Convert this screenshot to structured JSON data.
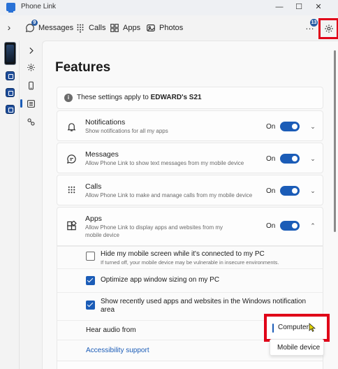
{
  "window": {
    "title": "Phone Link",
    "minimize": "—",
    "maximize": "☐",
    "close": "✕"
  },
  "topnav": {
    "expand_glyph": "›",
    "tabs": [
      {
        "label": "Messages",
        "icon": "message-icon",
        "badge": "9"
      },
      {
        "label": "Calls",
        "icon": "dialpad-icon"
      },
      {
        "label": "Apps",
        "icon": "apps-grid-icon"
      },
      {
        "label": "Photos",
        "icon": "photos-icon"
      }
    ],
    "more_glyph": "…",
    "more_badge": "13",
    "settings_icon": "gear-icon"
  },
  "rail": {
    "items": [
      {
        "name": "expand",
        "icon": "chevron-right-icon"
      },
      {
        "name": "general",
        "icon": "gear-icon"
      },
      {
        "name": "devices",
        "icon": "phone-icon"
      },
      {
        "name": "features",
        "icon": "list-icon",
        "active": true
      },
      {
        "name": "accessibility",
        "icon": "link-icon"
      }
    ]
  },
  "page": {
    "title": "Features",
    "info": {
      "prefix": "These settings apply to ",
      "device": "EDWARD's S21"
    },
    "features": [
      {
        "title": "Notifications",
        "desc": "Show notifications for all my apps",
        "state": "On",
        "icon": "bell-icon"
      },
      {
        "title": "Messages",
        "desc": "Allow Phone Link to show text messages from my mobile device",
        "state": "On",
        "icon": "chat-icon"
      },
      {
        "title": "Calls",
        "desc": "Allow Phone Link to make and manage calls from my mobile device",
        "state": "On",
        "icon": "dialpad-icon"
      },
      {
        "title": "Apps",
        "desc": "Allow Phone Link to display apps and websites from my mobile device",
        "state": "On",
        "icon": "apps-icon"
      }
    ],
    "apps_options": [
      {
        "label": "Hide my mobile screen while it's connected to my PC",
        "desc": "If turned off, your mobile device may be vulnerable in insecure environments.",
        "checked": false
      },
      {
        "label": "Optimize app window sizing on my PC",
        "checked": true
      },
      {
        "label": "Show recently used apps and websites in the Windows notification area",
        "checked": true
      }
    ],
    "hear_audio": {
      "label": "Hear audio from",
      "options": [
        "Computer",
        "Mobile device"
      ],
      "selected": "Computer"
    },
    "accessibility_link": "Accessibility support"
  },
  "colors": {
    "accent": "#1b5cb7",
    "highlight": "#e00018"
  }
}
